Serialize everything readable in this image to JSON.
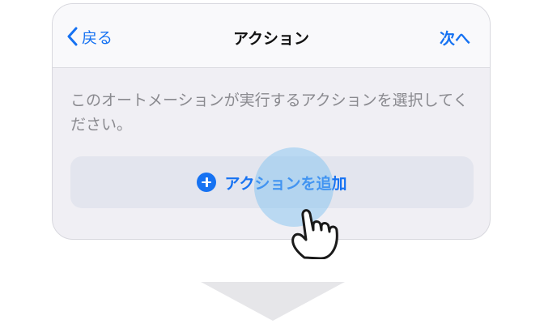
{
  "nav": {
    "back_label": "戻る",
    "title": "アクション",
    "next_label": "次へ"
  },
  "description": "このオートメーションが実行するアクションを選択してください。",
  "add_action": {
    "label": "アクションを追加"
  },
  "colors": {
    "accent": "#1672f2",
    "card_background": "#f0eff4",
    "nav_background": "#f9f9fb",
    "button_background": "#e3e5ee",
    "description_text": "#8a8a8f",
    "tap_highlight": "#78bef0",
    "arrow": "#e6e6e9"
  },
  "icons": {
    "back": "chevron-left-icon",
    "add": "plus-circle-icon",
    "pointer": "pointing-hand-icon",
    "next_step": "down-arrow-icon"
  }
}
